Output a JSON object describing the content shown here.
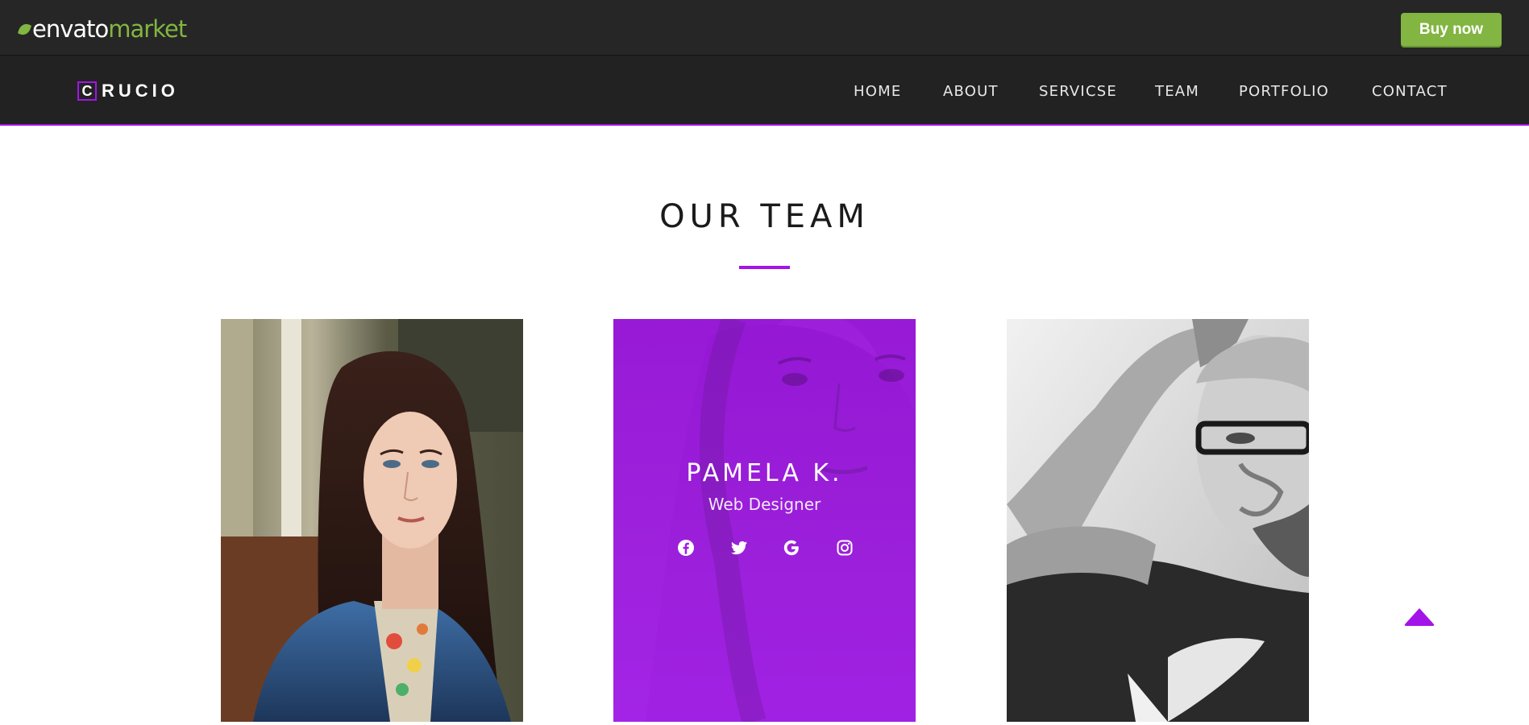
{
  "envato_bar": {
    "logo_main": "envato",
    "logo_accent": "market",
    "buy_button_label": "Buy now",
    "accent_color": "#82b541"
  },
  "site_header": {
    "brand_initial": "C",
    "brand_rest": "RUCIO",
    "accent_color": "#a314e8",
    "nav_items": [
      {
        "label": "HOME"
      },
      {
        "label": "ABOUT"
      },
      {
        "label": "SERVICSE"
      },
      {
        "label": "TEAM"
      },
      {
        "label": "PORTFOLIO"
      },
      {
        "label": "CONTACT"
      }
    ]
  },
  "team_section": {
    "title": "OUR TEAM",
    "members": [
      {
        "photo": "woman-denim-jacket-photo"
      },
      {
        "name": "PAMELA K.",
        "role": "Web Designer",
        "social_icons": [
          "facebook-icon",
          "twitter-icon",
          "google-icon",
          "instagram-icon"
        ]
      },
      {
        "photo": "man-glasses-bw-photo"
      }
    ]
  },
  "scroll_top": {
    "icon": "arrow-up-icon",
    "color": "#a314e8"
  }
}
